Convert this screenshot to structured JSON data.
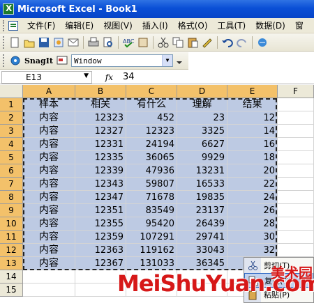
{
  "window": {
    "title": "Microsoft Excel - Book1"
  },
  "menu": [
    "文件(F)",
    "编辑(E)",
    "视图(V)",
    "插入(I)",
    "格式(O)",
    "工具(T)",
    "数据(D)",
    "窗"
  ],
  "snagit": {
    "label": "SnagIt",
    "dropdown_value": "Window"
  },
  "formula_bar": {
    "name_box": "E13",
    "fx": "fx",
    "value": "34"
  },
  "columns": [
    "A",
    "B",
    "C",
    "D",
    "E",
    "F"
  ],
  "rows": [
    "1",
    "2",
    "3",
    "4",
    "5",
    "6",
    "7",
    "8",
    "9",
    "10",
    "11",
    "12",
    "13",
    "14",
    "15"
  ],
  "header_row": [
    "样本",
    "相关",
    "有什么",
    "理解",
    "结果"
  ],
  "data_rows": [
    [
      "内容",
      "12323",
      "452",
      "23",
      "12"
    ],
    [
      "内容",
      "12327",
      "12323",
      "3325",
      "14"
    ],
    [
      "内容",
      "12331",
      "24194",
      "6627",
      "16"
    ],
    [
      "内容",
      "12335",
      "36065",
      "9929",
      "18"
    ],
    [
      "内容",
      "12339",
      "47936",
      "13231",
      "20"
    ],
    [
      "内容",
      "12343",
      "59807",
      "16533",
      "22"
    ],
    [
      "内容",
      "12347",
      "71678",
      "19835",
      "24"
    ],
    [
      "内容",
      "12351",
      "83549",
      "23137",
      "26"
    ],
    [
      "内容",
      "12355",
      "95420",
      "26439",
      "28"
    ],
    [
      "内容",
      "12359",
      "107291",
      "29741",
      "30"
    ],
    [
      "内容",
      "12363",
      "119162",
      "33043",
      "32"
    ],
    [
      "内容",
      "12367",
      "131033",
      "36345",
      ""
    ]
  ],
  "context_menu": [
    "剪切(T)",
    "复制(C)",
    "粘贴(P)"
  ],
  "watermark": {
    "text": "MeiShuYuan.com",
    "cn": "美术园"
  },
  "colors": {
    "selection": "#bdcae3",
    "header_selected": "#f3c16a",
    "title_blue": "#0a4fd6"
  }
}
